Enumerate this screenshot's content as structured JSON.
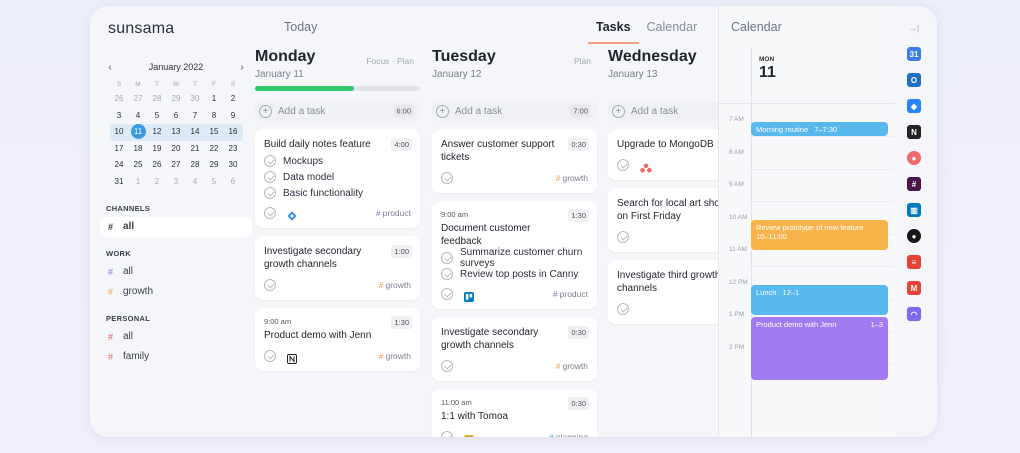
{
  "header": {
    "logo": "sunsama",
    "today_label": "Today",
    "tabs": [
      {
        "label": "Tasks",
        "active": true
      },
      {
        "label": "Calendar",
        "active": false
      }
    ],
    "calendar_title": "Calendar"
  },
  "mini_calendar": {
    "month": "January 2022",
    "prev": "‹",
    "next": "›",
    "dow": [
      "S",
      "M",
      "T",
      "W",
      "T",
      "F",
      "S"
    ],
    "weeks": [
      [
        "26",
        "27",
        "28",
        "29",
        "30",
        "1",
        "2"
      ],
      [
        "3",
        "4",
        "5",
        "6",
        "7",
        "8",
        "9"
      ],
      [
        "10",
        "11",
        "12",
        "13",
        "14",
        "15",
        "16"
      ],
      [
        "17",
        "18",
        "19",
        "20",
        "21",
        "22",
        "23"
      ],
      [
        "24",
        "25",
        "26",
        "27",
        "28",
        "29",
        "30"
      ],
      [
        "31",
        "1",
        "2",
        "3",
        "4",
        "5",
        "6"
      ]
    ],
    "selected": "11"
  },
  "sidebar": {
    "channels_title": "CHANNELS",
    "channels": [
      {
        "hash": "#",
        "label": "all",
        "color": "#2b2e3b"
      }
    ],
    "work_title": "WORK",
    "work": [
      {
        "hash": "#",
        "label": "all",
        "color": "#7f76d6"
      },
      {
        "hash": "#",
        "label": "growth",
        "color": "#f1a23c"
      }
    ],
    "personal_title": "PERSONAL",
    "personal": [
      {
        "hash": "#",
        "label": "all",
        "color": "#e0615b"
      },
      {
        "hash": "#",
        "label": "family",
        "color": "#e0615b"
      }
    ]
  },
  "days": [
    {
      "title": "Monday",
      "date": "January 11",
      "links": "Focus · Plan",
      "progress": 0.6,
      "add_task": "Add a task",
      "add_dur": "6:00",
      "cards": [
        {
          "time": "",
          "title": "Build daily notes feature",
          "dur": "4:00",
          "subtasks": [
            "Mockups",
            "Data model",
            "Basic functionality"
          ],
          "icon": "jira-icon",
          "tag": "product",
          "tag_color": "#7f76d6"
        },
        {
          "time": "",
          "title": "Investigate secondary growth channels",
          "dur": "1:00",
          "subtasks": [],
          "icon": "",
          "tag": "growth",
          "tag_color": "#f1a23c"
        },
        {
          "time": "9:00 am",
          "title": "Product demo with Jenn",
          "dur": "1:30",
          "subtasks": [],
          "icon": "notion-icon",
          "tag": "growth",
          "tag_color": "#f1a23c"
        }
      ]
    },
    {
      "title": "Tuesday",
      "date": "January 12",
      "links": "Plan",
      "add_task": "Add a task",
      "add_dur": "7:00",
      "cards": [
        {
          "time": "",
          "title": "Answer customer support tickets",
          "dur": "0:30",
          "subtasks": [],
          "icon": "",
          "tag": "growth",
          "tag_color": "#f1a23c"
        },
        {
          "time": "9:00 am",
          "title": "Document customer feedback",
          "dur": "1:30",
          "subtasks": [
            "Summarize customer churn surveys",
            "Review top posts in Canny"
          ],
          "icon": "trello-icon",
          "tag": "product",
          "tag_color": "#7f76d6"
        },
        {
          "time": "",
          "title": "Investigate secondary growth channels",
          "dur": "0:30",
          "subtasks": [],
          "icon": "",
          "tag": "growth",
          "tag_color": "#f1a23c"
        },
        {
          "time": "11:00 am",
          "title": "1:1 with Tomoa",
          "dur": "0:30",
          "subtasks": [],
          "icon": "gcal-icon",
          "tag": "planning",
          "tag_color": "#3aa6d8"
        }
      ]
    },
    {
      "title": "Wednesday",
      "date": "January 13",
      "links": "",
      "add_task": "Add a task",
      "add_dur": "",
      "cards": [
        {
          "time": "",
          "title": "Upgrade to MongoDB",
          "dur": "",
          "subtasks": [],
          "icon": "asana-icon",
          "tag": "",
          "tag_color": ""
        },
        {
          "time": "",
          "title": "Search for local art shows on First Friday",
          "dur": "",
          "subtasks": [],
          "icon": "",
          "tag": "",
          "tag_color": ""
        },
        {
          "time": "",
          "title": "Investigate third growth channels",
          "dur": "",
          "subtasks": [],
          "icon": "",
          "tag": "",
          "tag_color": ""
        }
      ]
    }
  ],
  "right_calendar": {
    "dow": "MON",
    "day": "11",
    "hours": [
      "7 AM",
      "8 AM",
      "9 AM",
      "10 AM",
      "11 AM",
      "12 PM",
      "1 PM",
      "2 PM"
    ],
    "events": [
      {
        "title": "Morning routine",
        "time": "7–7:30",
        "color": "#5ab9ec",
        "start": 7.0,
        "end": 7.5,
        "inline": true
      },
      {
        "title": "Review prototype of new feature",
        "time": "10–11:00",
        "color": "#f8b34b",
        "start": 10.0,
        "end": 11.0,
        "inline": false
      },
      {
        "title": "Lunch",
        "time": "12–1",
        "color": "#5ab9ec",
        "start": 12.0,
        "end": 13.0,
        "inline": true
      },
      {
        "title": "Product demo with Jenn",
        "time": "1–3",
        "color": "#a17cf0",
        "start": 13.0,
        "end": 15.0,
        "inline": true
      }
    ]
  },
  "integrations": {
    "collapse": "→|",
    "icons": [
      {
        "name": "google-calendar-icon",
        "glyph": "31",
        "color": "#3b7ee9"
      },
      {
        "name": "outlook-icon",
        "glyph": "O",
        "color": "#1c6fc4"
      },
      {
        "name": "jira-icon",
        "glyph": "◆",
        "color": "#2684ff"
      },
      {
        "name": "notion-icon",
        "glyph": "N",
        "color": "#222222"
      },
      {
        "name": "asana-icon",
        "glyph": "●",
        "color": "#f06a6a"
      },
      {
        "name": "slack-icon",
        "glyph": "#",
        "color": "#4a154b"
      },
      {
        "name": "trello-icon",
        "glyph": "▥",
        "color": "#0079bf"
      },
      {
        "name": "github-icon",
        "glyph": "●",
        "color": "#181717"
      },
      {
        "name": "todoist-icon",
        "glyph": "≡",
        "color": "#e44332"
      },
      {
        "name": "gmail-icon",
        "glyph": "M",
        "color": "#ea4335"
      },
      {
        "name": "clickup-icon",
        "glyph": "◠",
        "color": "#7b68ee"
      }
    ]
  }
}
